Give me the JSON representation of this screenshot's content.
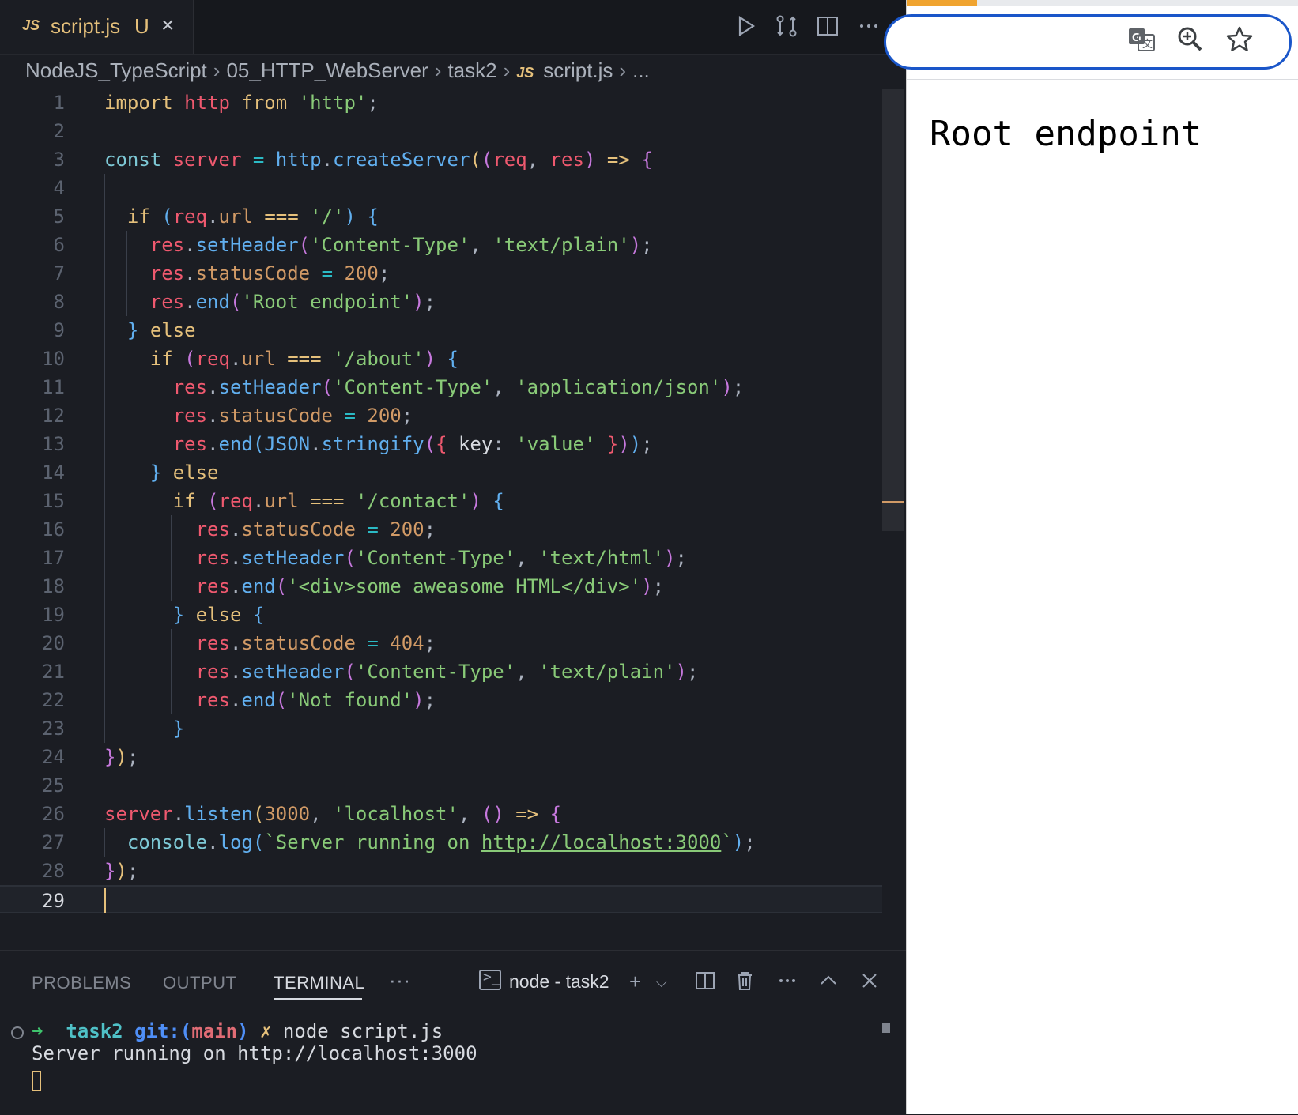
{
  "editor": {
    "tab": {
      "badge": "JS",
      "name": "script.js",
      "status": "U",
      "close_icon": "×"
    },
    "toolbar": [
      "run-icon",
      "compare-changes-icon",
      "split-editor-icon",
      "more-actions-icon"
    ],
    "breadcrumb": {
      "parts": [
        "NodeJS_TypeScript",
        "05_HTTP_WebServer",
        "task2"
      ],
      "file_badge": "JS",
      "file": "script.js",
      "tail": "..."
    },
    "current_line": 29,
    "line_numbers": [
      "1",
      "2",
      "3",
      "4",
      "5",
      "6",
      "7",
      "8",
      "9",
      "10",
      "11",
      "12",
      "13",
      "14",
      "15",
      "16",
      "17",
      "18",
      "19",
      "20",
      "21",
      "22",
      "23",
      "24",
      "25",
      "26",
      "27",
      "28",
      "29"
    ]
  },
  "panel": {
    "tabs": {
      "problems": "PROBLEMS",
      "output": "OUTPUT",
      "terminal": "TERMINAL",
      "more": "···"
    },
    "terminal_name": "node - task2",
    "prompt": {
      "arrow": "➜",
      "dir": "task2",
      "git_prefix": "git:(",
      "branch": "main",
      "git_suffix": ")",
      "dirty": "✗",
      "command": "node script.js"
    },
    "output": "Server running on http://localhost:3000"
  },
  "browser": {
    "omnibox_icons": [
      "translate-icon",
      "zoom-icon",
      "bookmark-star-icon"
    ],
    "page_content": "Root endpoint"
  },
  "colors": {
    "editor_bg": "#1b1d23",
    "keyword": "#e5c07b",
    "string": "#89ca78",
    "variable": "#ef596f",
    "function": "#61afef",
    "number": "#d19a66",
    "omnibox_border": "#1a56c9",
    "load_bar": "#f0a430"
  }
}
